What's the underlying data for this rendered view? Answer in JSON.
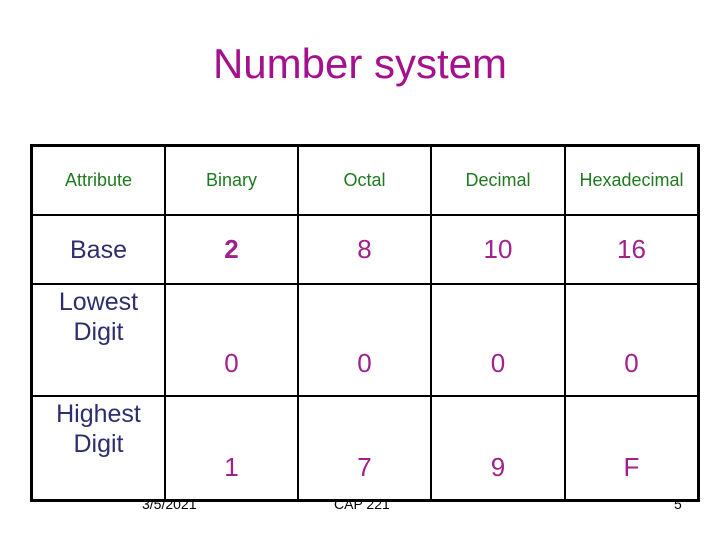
{
  "slide": {
    "title": "Number system",
    "table": {
      "headers": [
        "Attribute",
        "Binary",
        "Octal",
        "Decimal",
        "Hexadecimal"
      ],
      "rows": [
        {
          "label": "Base",
          "values": [
            "2",
            "8",
            "10",
            "16"
          ]
        },
        {
          "label": "Lowest Digit",
          "values": [
            "0",
            "0",
            "0",
            "0"
          ]
        },
        {
          "label": "Highest Digit",
          "values": [
            "1",
            "7",
            "9",
            "F"
          ]
        }
      ]
    },
    "footer": {
      "date": "3/5/2021",
      "course": "CAP 221",
      "page_number": "5"
    }
  }
}
